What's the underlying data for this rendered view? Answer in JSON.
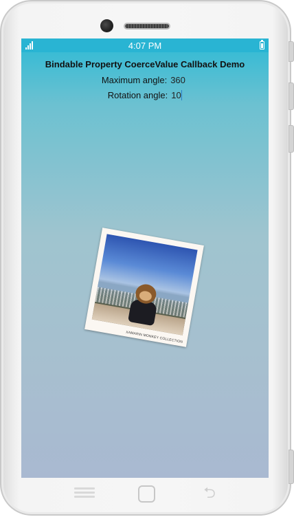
{
  "status_bar": {
    "time": "4:07 PM",
    "signal_icon": "signal-icon",
    "battery_icon": "battery-icon"
  },
  "page": {
    "title": "Bindable Property CoerceValue Callback Demo",
    "maximum_angle": {
      "label": "Maximum angle:",
      "value": "360"
    },
    "rotation_angle": {
      "label": "Rotation angle:",
      "value": "10"
    }
  },
  "photo": {
    "caption": "XAMARIN MONKEY COLLECTION",
    "rotation_degrees": 10
  },
  "nav_bar": {
    "menu_icon": "menu-icon",
    "home_icon": "home-icon",
    "back_icon": "back-icon",
    "back_glyph": "⮌"
  },
  "colors": {
    "status_bar": "#29b4d3",
    "gradient_top": "#2dbad5",
    "gradient_bottom": "#a9b9d1"
  }
}
